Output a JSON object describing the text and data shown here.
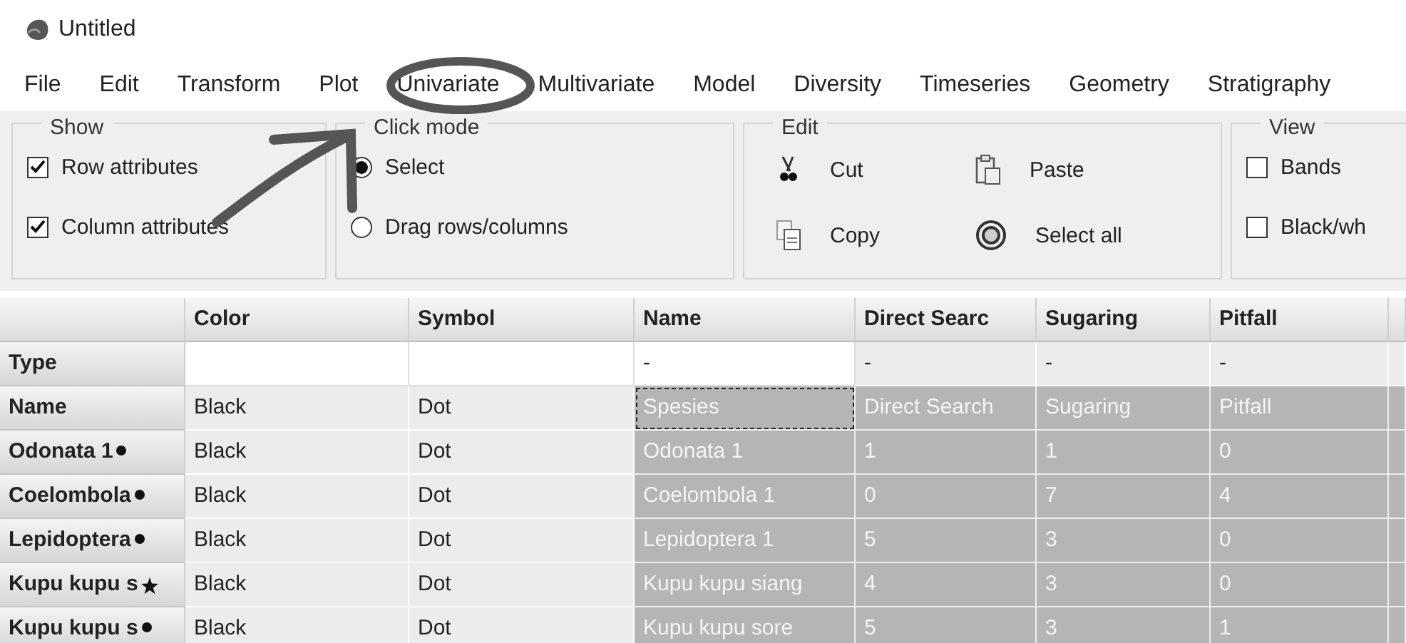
{
  "window": {
    "title": "Untitled"
  },
  "menu": [
    "File",
    "Edit",
    "Transform",
    "Plot",
    "Univariate",
    "Multivariate",
    "Model",
    "Diversity",
    "Timeseries",
    "Geometry",
    "Stratigraphy"
  ],
  "show": {
    "title": "Show",
    "options": [
      {
        "label": "Row attributes",
        "checked": true
      },
      {
        "label": "Column attributes",
        "checked": true
      }
    ]
  },
  "click_mode": {
    "title": "Click mode",
    "options": [
      {
        "label": "Select",
        "selected": true
      },
      {
        "label": "Drag rows/columns",
        "selected": false
      }
    ]
  },
  "edit": {
    "title": "Edit",
    "actions": [
      {
        "kind": "cut",
        "label": "Cut"
      },
      {
        "kind": "paste",
        "label": "Paste"
      },
      {
        "kind": "copy",
        "label": "Copy"
      },
      {
        "kind": "selectall",
        "label": "Select all"
      }
    ]
  },
  "view": {
    "title": "View",
    "options": [
      {
        "label": "Bands",
        "checked": false
      },
      {
        "label": "Black/wh",
        "checked": false
      }
    ]
  },
  "table": {
    "columns": [
      "Color",
      "Symbol",
      "Name",
      "Direct Searc",
      "Sugaring",
      "Pitfall"
    ],
    "rows": [
      {
        "header": "Type",
        "kind": "plain",
        "cells": [
          {
            "editable": true,
            "selected": false,
            "focused": false
          },
          {
            "editable": true,
            "selected": false,
            "focused": false
          },
          {
            "text": "-",
            "editable": true,
            "selected": false,
            "focused": false
          },
          {
            "text": "-",
            "editable": false,
            "selected": false,
            "focused": false
          },
          {
            "text": "-",
            "editable": false,
            "selected": false,
            "focused": false
          },
          {
            "text": "-",
            "editable": false,
            "selected": false,
            "focused": false
          }
        ]
      },
      {
        "header": "Name",
        "kind": "plain",
        "cells": [
          {
            "text": "Black",
            "selected": false,
            "focused": false
          },
          {
            "text": "Dot",
            "selected": false,
            "focused": false
          },
          {
            "text": "Spesies",
            "selected": true,
            "focused": true
          },
          {
            "text": "Direct Search",
            "selected": true,
            "focused": false
          },
          {
            "text": "Sugaring",
            "selected": true,
            "focused": false
          },
          {
            "text": "Pitfall",
            "selected": true,
            "focused": false
          }
        ]
      },
      {
        "header": "Odonata 1",
        "kind": "dot",
        "cells": [
          {
            "text": "Black",
            "selected": false,
            "focused": false
          },
          {
            "text": "Dot",
            "selected": false,
            "focused": false
          },
          {
            "text": "Odonata 1",
            "selected": true,
            "focused": false
          },
          {
            "text": "1",
            "selected": true,
            "focused": false
          },
          {
            "text": "1",
            "selected": true,
            "focused": false
          },
          {
            "text": "0",
            "selected": true,
            "focused": false
          }
        ]
      },
      {
        "header": "Coelombola",
        "kind": "dot",
        "cells": [
          {
            "text": "Black",
            "selected": false,
            "focused": false
          },
          {
            "text": "Dot",
            "selected": false,
            "focused": false
          },
          {
            "text": "Coelombola 1",
            "selected": true,
            "focused": false
          },
          {
            "text": "0",
            "selected": true,
            "focused": false
          },
          {
            "text": "7",
            "selected": true,
            "focused": false
          },
          {
            "text": "4",
            "selected": true,
            "focused": false
          }
        ]
      },
      {
        "header": "Lepidoptera",
        "kind": "dot",
        "cells": [
          {
            "text": "Black",
            "selected": false,
            "focused": false
          },
          {
            "text": "Dot",
            "selected": false,
            "focused": false
          },
          {
            "text": "Lepidoptera 1",
            "selected": true,
            "focused": false
          },
          {
            "text": "5",
            "selected": true,
            "focused": false
          },
          {
            "text": "3",
            "selected": true,
            "focused": false
          },
          {
            "text": "0",
            "selected": true,
            "focused": false
          }
        ]
      },
      {
        "header": "Kupu kupu s",
        "kind": "star",
        "cells": [
          {
            "text": "Black",
            "selected": false,
            "focused": false
          },
          {
            "text": "Dot",
            "selected": false,
            "focused": false
          },
          {
            "text": "Kupu kupu siang",
            "selected": true,
            "focused": false
          },
          {
            "text": "4",
            "selected": true,
            "focused": false
          },
          {
            "text": "3",
            "selected": true,
            "focused": false
          },
          {
            "text": "0",
            "selected": true,
            "focused": false
          }
        ]
      },
      {
        "header": "Kupu kupu s",
        "kind": "dot",
        "cells": [
          {
            "text": "Black",
            "selected": false,
            "focused": false
          },
          {
            "text": "Dot",
            "selected": false,
            "focused": false
          },
          {
            "text": "Kupu kupu sore",
            "selected": true,
            "focused": false
          },
          {
            "text": "5",
            "selected": true,
            "focused": false
          },
          {
            "text": "3",
            "selected": true,
            "focused": false
          },
          {
            "text": "1",
            "selected": true,
            "focused": false
          }
        ]
      }
    ]
  }
}
